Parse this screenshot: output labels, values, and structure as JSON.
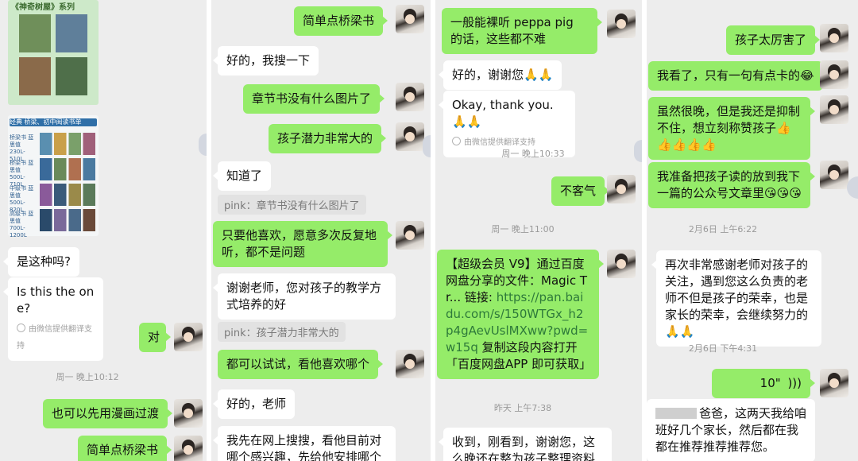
{
  "panel1": {
    "poster1": {
      "title": "《神奇树屋》系列"
    },
    "poster2": {
      "header": "经典 桥梁、初中阅读书单",
      "levels": [
        "桥梁书 蓝思值 230L-510L",
        "桥梁书 蓝思值 500L-710L",
        "中级书 蓝思值 500L-820L",
        "高级书 蓝思值 700L-1200L"
      ]
    },
    "msg_is_this": "是这种吗?",
    "msg_translation": "Is this the one?",
    "translation_note": "由微信提供翻译支持",
    "msg_yes": "对",
    "time1": "周一 晚上10:12",
    "msg_comic": "也可以先用漫画过渡",
    "msg_bridge_cut": "简单点桥梁书"
  },
  "panel2": {
    "msg_bridge": "简单点桥梁书",
    "msg_search": "好的，我搜一下",
    "msg_chapter": "章节书没有什么图片了",
    "msg_potential": "孩子潜力非常大的",
    "msg_know": "知道了",
    "quote_chapter": "pink：章节书没有什么图片了",
    "msg_likes": "只要他喜欢，愿意多次反复地听，都不是问题",
    "msg_thanks": "谢谢老师，您对孩子的教学方式培养的好",
    "quote_potential": "pink：孩子潜力非常大的",
    "msg_try": "都可以试试，看他喜欢哪个",
    "msg_ok_teacher": "好的，老师",
    "msg_online": "我先在网上搜搜，看他目前对哪个感兴趣，先给他安排哪个"
  },
  "panel3": {
    "msg_peppa": "一般能裸听 peppa pig 的话，这些都不难",
    "msg_ok_thanks": "好的，谢谢您🙏🙏",
    "msg_okay_thank_you": "Okay, thank you.🙏🙏",
    "translation_note": "由微信提供翻译支持",
    "time1": "周一 晚上10:33",
    "msg_welcome": "不客气",
    "time2": "周一 晚上11:00",
    "share_prefix": "【超级会员 V9】通过百度网盘分享的文件：Magic Tr... 链接:",
    "share_link": "https://pan.baidu.com/s/150WTGx_h2p4gAevUslMXww?pwd=w15q",
    "share_suffix": "复制这段内容打开「百度网盘APP 即可获取」",
    "time3": "昨天 上午7:38",
    "msg_received": "收到，刚看到，谢谢您，这么晚还在整为孩子整理资料"
  },
  "panel4": {
    "msg_great": "孩子太厉害了",
    "msg_read": "我看了，只有一句有点卡的😂",
    "msg_late": "虽然很晚，但是我还是抑制不住，想立刻称赞孩子👍👍👍👍👍",
    "msg_post": "我准备把孩子读的放到我下一篇的公众号文章里😘😘😘",
    "time1": "2月6日 上午6:22",
    "msg_gratitude": "再次非常感谢老师对孩子的关注，遇到您这么负责的老师不但是孩子的荣幸，也是家长的荣幸，会继续努力的🙏🙏",
    "time2": "2月6日 下午4:31",
    "voice_duration": "10\"",
    "msg_parents": "爸爸，这两天我给咱班好几个家长，然后都在我都在推荐推荐推荐您。"
  },
  "colors": {
    "sent_bubble": "#95ec69",
    "received_bubble": "#ffffff",
    "chat_bg": "#ededed"
  }
}
